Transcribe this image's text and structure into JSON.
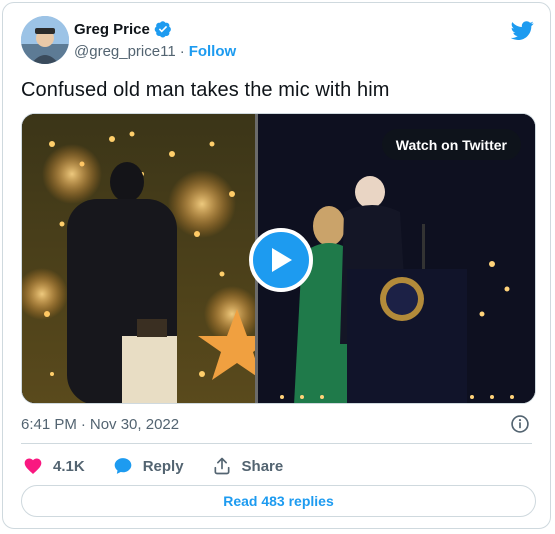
{
  "author": {
    "name": "Greg Price",
    "handle": "@greg_price11",
    "follow_label": "Follow",
    "separator": "·"
  },
  "tweet": {
    "text": "Confused old man takes the mic with him",
    "timestamp_time": "6:41 PM",
    "timestamp_date": "Nov 30, 2022"
  },
  "media": {
    "watch_label": "Watch on Twitter"
  },
  "actions": {
    "likes": "4.1K",
    "reply_label": "Reply",
    "share_label": "Share"
  },
  "read_replies_label": "Read 483 replies",
  "colors": {
    "brand": "#1d9bf0",
    "like": "#f91880",
    "secondary_text": "#536471",
    "border": "#cfd9de"
  },
  "icons": {
    "verified": "verified-badge-icon",
    "twitter": "twitter-bird-icon",
    "info": "info-icon",
    "like": "heart-icon",
    "reply": "speech-bubble-icon",
    "share": "share-icon",
    "play": "play-icon"
  }
}
